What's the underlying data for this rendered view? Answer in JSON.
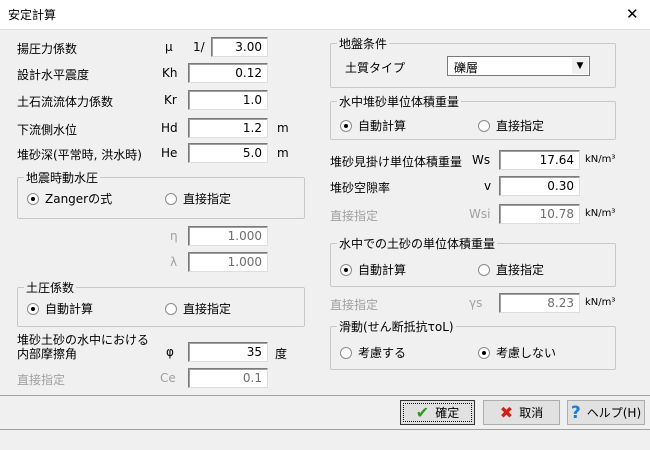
{
  "window": {
    "title": "安定計算",
    "close": "✕"
  },
  "left": {
    "rows": [
      {
        "label": "揚圧力係数",
        "symbol": "μ",
        "prefix": "1/",
        "value": "3.00",
        "unit": ""
      },
      {
        "label": "設計水平震度",
        "symbol": "Kh",
        "value": "0.12",
        "unit": ""
      },
      {
        "label": "土石流流体力係数",
        "symbol": "Kr",
        "value": "1.0",
        "unit": ""
      },
      {
        "label": "下流側水位",
        "symbol": "Hd",
        "value": "1.2",
        "unit": "m"
      },
      {
        "label": "堆砂深(平常時, 洪水時)",
        "symbol": "He",
        "value": "5.0",
        "unit": "m"
      }
    ],
    "seismic_group": {
      "title": "地震時動水圧",
      "options": [
        "Zangerの式",
        "直接指定"
      ],
      "selected": 0
    },
    "eta": {
      "symbol": "η",
      "value": "1.000"
    },
    "lambda": {
      "symbol": "λ",
      "value": "1.000"
    },
    "earth_group": {
      "title": "土圧係数",
      "options": [
        "自動計算",
        "直接指定"
      ],
      "selected": 0
    },
    "friction": {
      "label1": "堆砂土砂の水中における",
      "label2": "内部摩擦角",
      "symbol": "φ",
      "value": "35",
      "unit": "度"
    },
    "ce": {
      "label": "直接指定",
      "symbol": "Ce",
      "value": "0.1"
    }
  },
  "right": {
    "ground_group": {
      "title": "地盤条件",
      "soil_label": "土質タイプ",
      "soil_value": "礫層"
    },
    "water_group": {
      "title": "水中堆砂単位体積重量",
      "options": [
        "自動計算",
        "直接指定"
      ],
      "selected": 0
    },
    "ws": {
      "label": "堆砂見掛け単位体積重量",
      "symbol": "Ws",
      "value": "17.64",
      "unit": "kN/m³"
    },
    "v": {
      "label": "堆砂空隙率",
      "symbol": "v",
      "value": "0.30"
    },
    "wsi": {
      "label": "直接指定",
      "symbol": "Wsi",
      "value": "10.78",
      "unit": "kN/m³"
    },
    "soil_water_group": {
      "title": "水中での土砂の単位体積重量",
      "options": [
        "自動計算",
        "直接指定"
      ],
      "selected": 0
    },
    "gs": {
      "label": "直接指定",
      "symbol": "γs",
      "value": "8.23",
      "unit": "kN/m³"
    },
    "slide_group": {
      "title": "滑動(せん断抵抗τoL)",
      "options": [
        "考慮する",
        "考慮しない"
      ],
      "selected": 1
    }
  },
  "buttons": {
    "ok": "確定",
    "cancel": "取消",
    "help": "ヘルプ(H)"
  },
  "colors": {
    "ok_check": "#2a9a1e",
    "cancel_x": "#d0201a",
    "help_q": "#1e7ad6"
  }
}
